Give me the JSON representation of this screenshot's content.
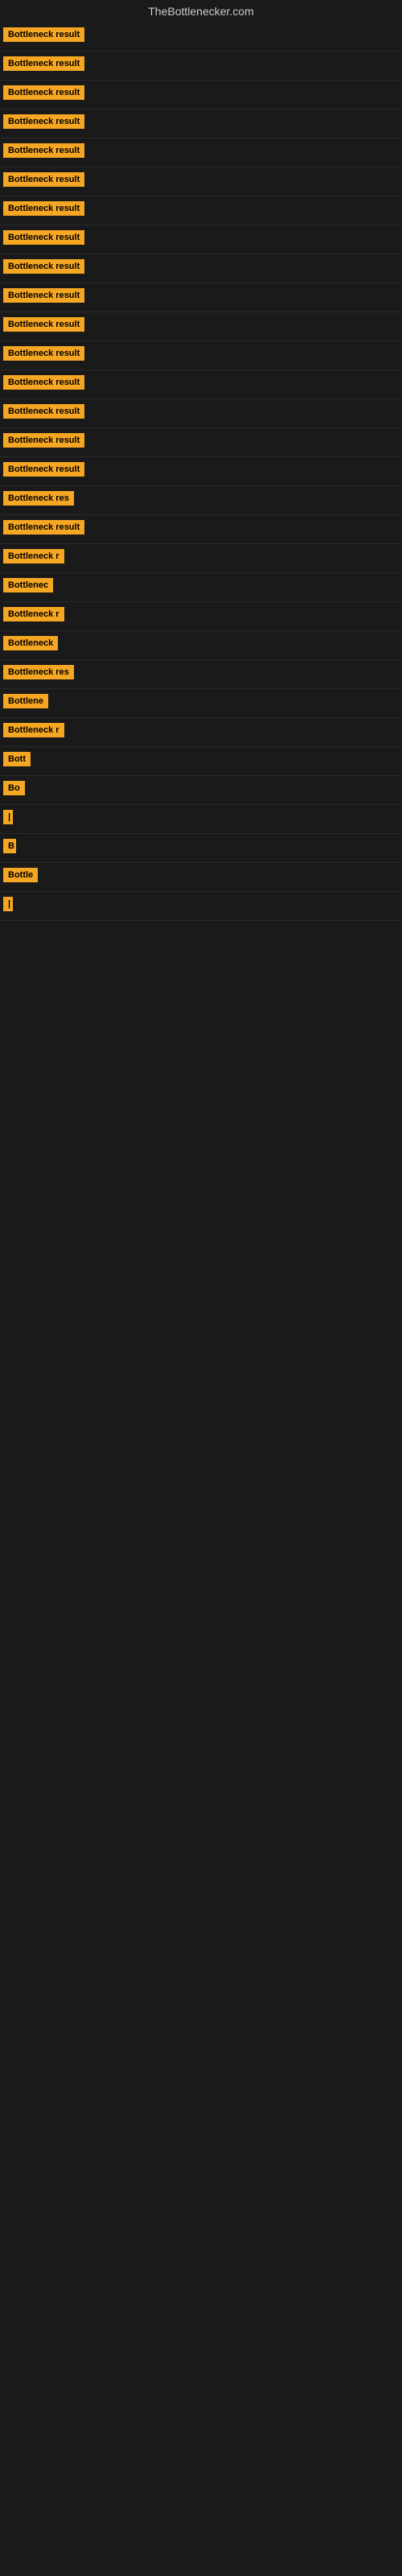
{
  "header": {
    "title": "TheBottlenecker.com"
  },
  "items": [
    {
      "label": "Bottleneck result",
      "width": 130
    },
    {
      "label": "Bottleneck result",
      "width": 130
    },
    {
      "label": "Bottleneck result",
      "width": 130
    },
    {
      "label": "Bottleneck result",
      "width": 128
    },
    {
      "label": "Bottleneck result",
      "width": 130
    },
    {
      "label": "Bottleneck result",
      "width": 128
    },
    {
      "label": "Bottleneck result",
      "width": 126
    },
    {
      "label": "Bottleneck result",
      "width": 124
    },
    {
      "label": "Bottleneck result",
      "width": 124
    },
    {
      "label": "Bottleneck result",
      "width": 122
    },
    {
      "label": "Bottleneck result",
      "width": 120
    },
    {
      "label": "Bottleneck result",
      "width": 118
    },
    {
      "label": "Bottleneck result",
      "width": 116
    },
    {
      "label": "Bottleneck result",
      "width": 114
    },
    {
      "label": "Bottleneck result",
      "width": 112
    },
    {
      "label": "Bottleneck result",
      "width": 110
    },
    {
      "label": "Bottleneck res",
      "width": 100
    },
    {
      "label": "Bottleneck result",
      "width": 108
    },
    {
      "label": "Bottleneck r",
      "width": 88
    },
    {
      "label": "Bottlenec",
      "width": 76
    },
    {
      "label": "Bottleneck r",
      "width": 88
    },
    {
      "label": "Bottleneck",
      "width": 80
    },
    {
      "label": "Bottleneck res",
      "width": 100
    },
    {
      "label": "Bottlene",
      "width": 70
    },
    {
      "label": "Bottleneck r",
      "width": 88
    },
    {
      "label": "Bott",
      "width": 42
    },
    {
      "label": "Bo",
      "width": 28
    },
    {
      "label": "|",
      "width": 10
    },
    {
      "label": "B",
      "width": 16
    },
    {
      "label": "Bottle",
      "width": 52
    },
    {
      "label": "|",
      "width": 10
    }
  ]
}
